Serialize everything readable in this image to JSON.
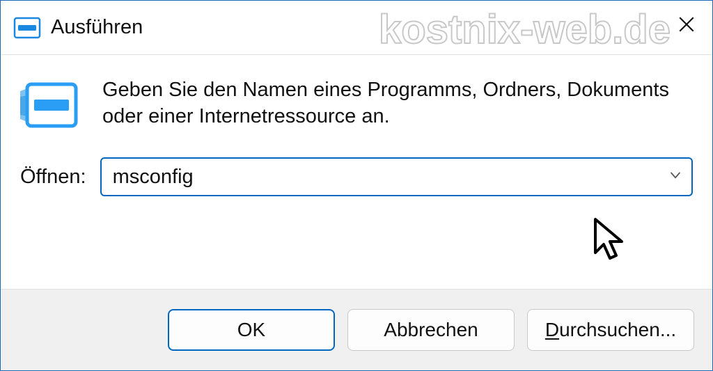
{
  "window": {
    "title": "Ausführen"
  },
  "watermark": "kostnix-web.de",
  "content": {
    "description": "Geben Sie den Namen eines Programms, Ordners, Dokuments oder einer Internetressource an.",
    "open_label": "Öffnen:",
    "input_value": "msconfig"
  },
  "buttons": {
    "ok": "OK",
    "cancel": "Abbrechen",
    "browse_prefix": "D",
    "browse_rest": "urchsuchen..."
  }
}
